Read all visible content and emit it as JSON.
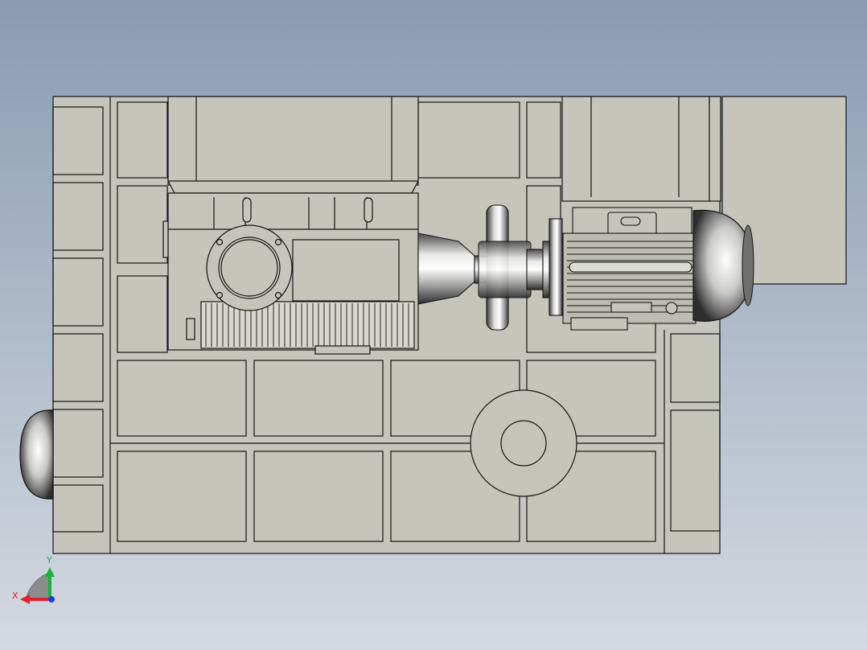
{
  "viewport": {
    "background_top": "#8a9bb2",
    "background_bottom": "#d4d9e1"
  },
  "model": {
    "part_fill": "#c6c5bc",
    "edge_color": "#141414",
    "metal_light": "#f1f1ef",
    "metal_dark": "#3a3a3a"
  },
  "triad": {
    "x_label": "X",
    "y_label": "Y",
    "x_color": "#e0202a",
    "y_color": "#19b23c",
    "z_color": "#1c3fd6"
  }
}
